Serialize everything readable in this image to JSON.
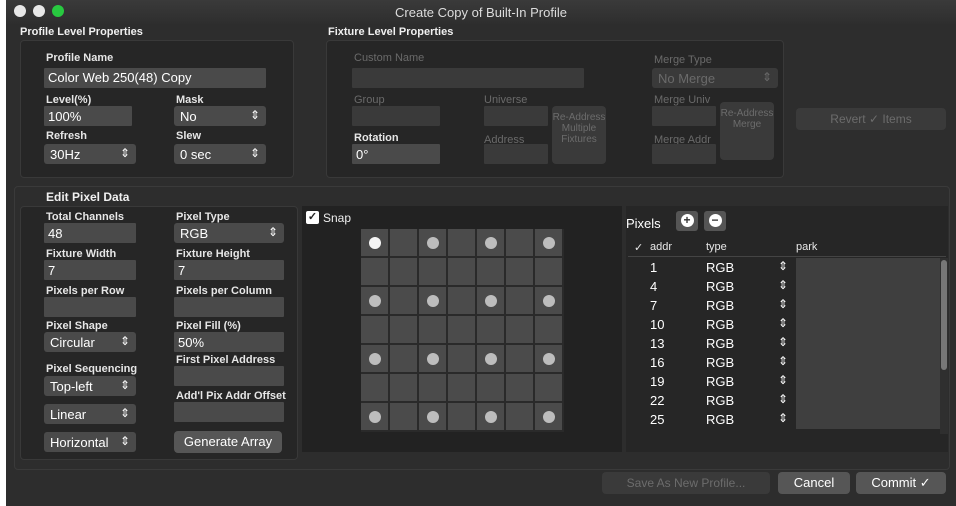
{
  "window": {
    "title": "Create Copy of Built-In Profile"
  },
  "profile_section": {
    "title": "Profile Level Properties",
    "name_label": "Profile Name",
    "name_value": "Color Web 250(48) Copy",
    "level_label": "Level(%)",
    "level_value": "100%",
    "mask_label": "Mask",
    "mask_value": "No",
    "refresh_label": "Refresh",
    "refresh_value": "30Hz",
    "slew_label": "Slew",
    "slew_value": "0 sec"
  },
  "fixture_section": {
    "title": "Fixture Level Properties",
    "custom_name_label": "Custom Name",
    "merge_type_label": "Merge Type",
    "merge_type_value": "No Merge",
    "group_label": "Group",
    "universe_label": "Universe",
    "address_label": "Address",
    "readdress_button": "Re-Address Multiple Fixtures",
    "merge_univ_label": "Merge Univ",
    "merge_addr_label": "Merge Addr",
    "readdress_merge_button": "Re-Address Merge",
    "rotation_label": "Rotation",
    "rotation_value": "0°",
    "revert_button": "Revert ✓ Items"
  },
  "pixel_section": {
    "title": "Edit Pixel Data",
    "total_channels_label": "Total Channels",
    "total_channels_value": "48",
    "pixel_type_label": "Pixel Type",
    "pixel_type_value": "RGB",
    "fixture_width_label": "Fixture Width",
    "fixture_width_value": "7",
    "fixture_height_label": "Fixture Height",
    "fixture_height_value": "7",
    "pixels_per_row_label": "Pixels per Row",
    "pixels_per_column_label": "Pixels per Column",
    "pixel_shape_label": "Pixel Shape",
    "pixel_shape_value": "Circular",
    "pixel_fill_label": "Pixel Fill (%)",
    "pixel_fill_value": "50%",
    "pixel_sequencing_label": "Pixel Sequencing",
    "pixel_sequencing_value": "Top-left",
    "first_pixel_address_label": "First Pixel Address",
    "addl_offset_label": "Add'l Pix Addr Offset",
    "linear_value": "Linear",
    "direction_value": "Horizontal",
    "generate_button": "Generate Array",
    "snap_label": "Snap"
  },
  "grid": {
    "cols": 7,
    "rows": 7,
    "dots": [
      [
        0,
        0
      ],
      [
        2,
        0
      ],
      [
        4,
        0
      ],
      [
        6,
        0
      ],
      [
        0,
        2
      ],
      [
        2,
        2
      ],
      [
        4,
        2
      ],
      [
        6,
        2
      ],
      [
        0,
        4
      ],
      [
        2,
        4
      ],
      [
        4,
        4
      ],
      [
        6,
        4
      ],
      [
        0,
        6
      ],
      [
        2,
        6
      ],
      [
        4,
        6
      ],
      [
        6,
        6
      ]
    ],
    "selected_dot": [
      0,
      0
    ]
  },
  "pixels_table": {
    "title": "Pixels",
    "columns": {
      "check": "✓",
      "addr": "addr",
      "type": "type",
      "park": "park"
    },
    "rows": [
      {
        "addr": "1",
        "type": "RGB"
      },
      {
        "addr": "4",
        "type": "RGB"
      },
      {
        "addr": "7",
        "type": "RGB"
      },
      {
        "addr": "10",
        "type": "RGB"
      },
      {
        "addr": "13",
        "type": "RGB"
      },
      {
        "addr": "16",
        "type": "RGB"
      },
      {
        "addr": "19",
        "type": "RGB"
      },
      {
        "addr": "22",
        "type": "RGB"
      },
      {
        "addr": "25",
        "type": "RGB"
      }
    ]
  },
  "footer": {
    "save_button": "Save As New Profile...",
    "cancel_button": "Cancel",
    "commit_button": "Commit ✓"
  },
  "colors": {
    "window_bg": "#2d2d2d",
    "panel_bg": "#262626",
    "field_bg": "#4a4a4a",
    "close": "#ff5f57",
    "minimize": "#ffbd2e",
    "zoom": "#28c940",
    "checkbox": "#ffffff"
  }
}
